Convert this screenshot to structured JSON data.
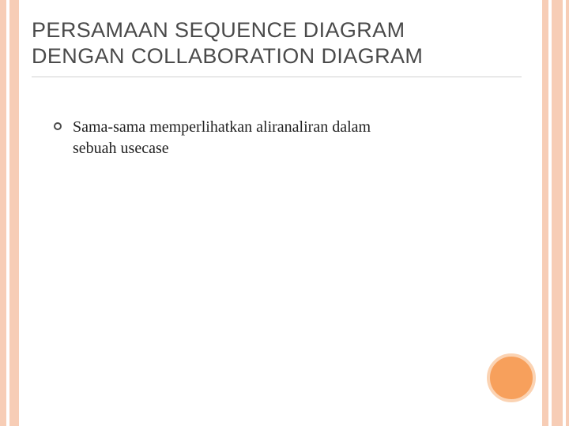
{
  "title_line1": "PERSAMAAN SEQUENCE DIAGRAM",
  "title_line2": "DENGAN COLLABORATION DIAGRAM",
  "bullets": [
    "Sama-sama memperlihatkan aliranaliran dalam sebuah usecase"
  ]
}
